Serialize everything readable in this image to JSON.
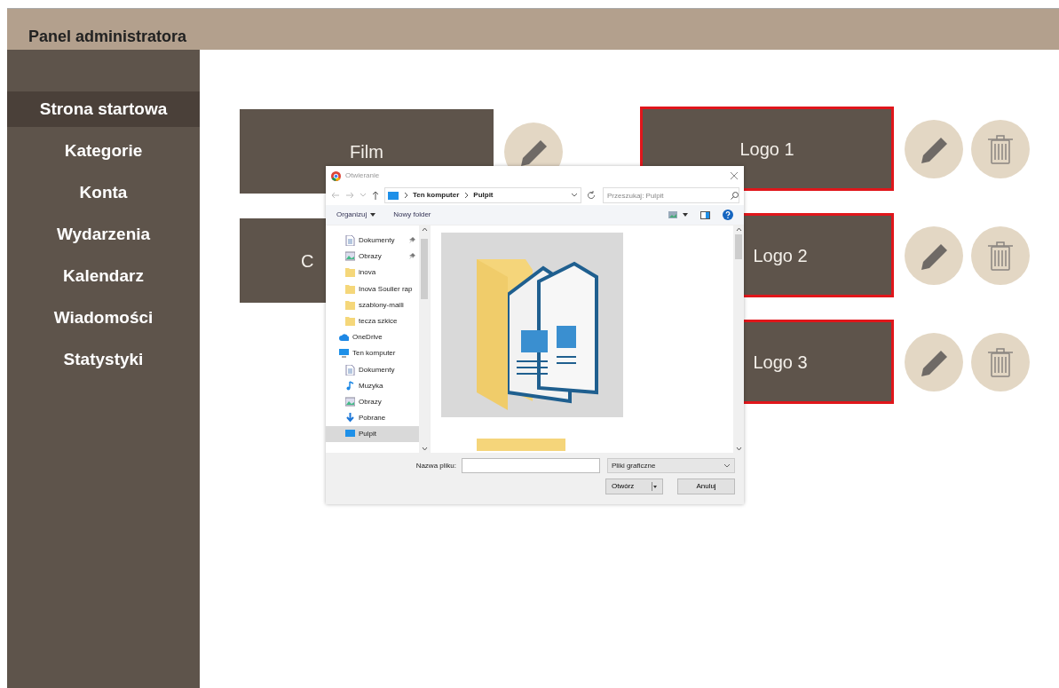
{
  "header": {
    "title": "Panel administratora"
  },
  "sidebar": {
    "items": [
      {
        "label": "Strona startowa",
        "selected": true
      },
      {
        "label": "Kategorie",
        "selected": false
      },
      {
        "label": "Konta",
        "selected": false
      },
      {
        "label": "Wydarzenia",
        "selected": false
      },
      {
        "label": "Kalendarz",
        "selected": false
      },
      {
        "label": "Wiadomości",
        "selected": false
      },
      {
        "label": "Statystyki",
        "selected": false
      }
    ]
  },
  "tile_columns": [
    {
      "tiles": [
        {
          "label": "Film",
          "highlighted": false,
          "actions": [
            {
              "kind": "edit"
            }
          ]
        },
        {
          "label": "C",
          "highlighted": false
        }
      ]
    },
    {
      "tiles": [
        {
          "label": "Logo 1",
          "highlighted": true,
          "actions": [
            {
              "kind": "edit"
            },
            {
              "kind": "delete"
            }
          ]
        },
        {
          "label": "Logo 2",
          "highlighted": true,
          "actions": [
            {
              "kind": "edit"
            },
            {
              "kind": "delete"
            }
          ]
        },
        {
          "label": "Logo 3",
          "highlighted": true,
          "actions": [
            {
              "kind": "edit"
            },
            {
              "kind": "delete"
            }
          ]
        }
      ]
    }
  ],
  "dialog": {
    "title": "Otwieranie",
    "breadcrumb": [
      "Ten komputer",
      "Pulpit"
    ],
    "search": {
      "placeholder": "Przeszukaj: Pulpit"
    },
    "toolbar": {
      "organize": "Organizuj",
      "new_folder": "Nowy folder"
    },
    "nav_pane": {
      "items": [
        {
          "children": [
            {
              "label": "Dokumenty",
              "kind": "doc",
              "pinned": true,
              "selected": false
            },
            {
              "label": "Obrazy",
              "kind": "pictures",
              "pinned": true,
              "selected": false
            },
            {
              "label": "inova",
              "kind": "folder",
              "pinned": false,
              "selected": false
            },
            {
              "label": "Inova Soulier rap",
              "kind": "folder",
              "pinned": false,
              "selected": false
            },
            {
              "label": "szablony-maili",
              "kind": "folder",
              "pinned": false,
              "selected": false
            },
            {
              "label": "tecza szkice",
              "kind": "folder",
              "pinned": false,
              "selected": false
            }
          ]
        },
        {
          "label": "OneDrive",
          "kind": "cloud",
          "pinned": false,
          "selected": false
        },
        {
          "label": "Ten komputer",
          "kind": "computer",
          "pinned": false,
          "selected": false,
          "children": [
            {
              "label": "Dokumenty",
              "kind": "doc",
              "pinned": false,
              "selected": false
            },
            {
              "label": "Muzyka",
              "kind": "music",
              "pinned": false,
              "selected": false
            },
            {
              "label": "Obrazy",
              "kind": "pictures",
              "pinned": false,
              "selected": false
            },
            {
              "label": "Pobrane",
              "kind": "download",
              "pinned": false,
              "selected": false
            },
            {
              "label": "Pulpit",
              "kind": "desktop",
              "pinned": false,
              "selected": true
            }
          ]
        }
      ]
    },
    "file_name": {
      "label": "Nazwa pliku:"
    },
    "file_type": "Pliki graficzne",
    "buttons": {
      "open": "Otwórz",
      "cancel": "Anuluj"
    }
  }
}
